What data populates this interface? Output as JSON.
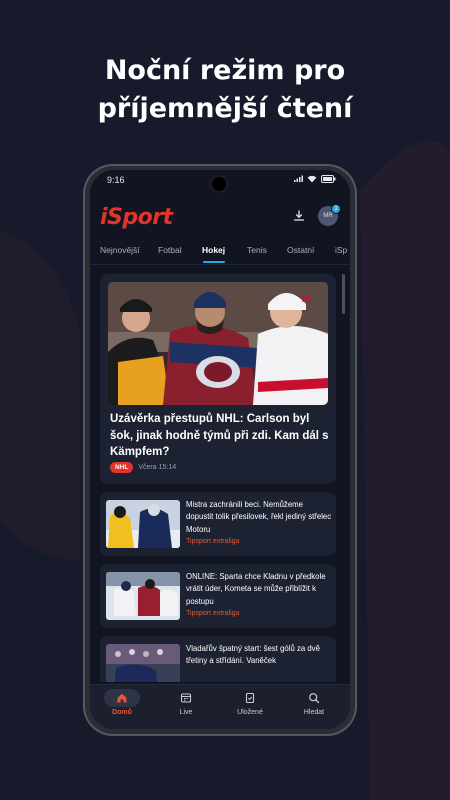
{
  "promo": {
    "line1": "Noční režim pro",
    "line2": "příjemnější čtení"
  },
  "status_bar": {
    "time": "9:16"
  },
  "app": {
    "logo": "iSport",
    "avatar_initials": "MR",
    "avatar_badge": "1"
  },
  "tabs": [
    {
      "label": "Nejnovější"
    },
    {
      "label": "Fotbal"
    },
    {
      "label": "Hokej",
      "active": true
    },
    {
      "label": "Tenis"
    },
    {
      "label": "Ostatní"
    },
    {
      "label": "iSp"
    }
  ],
  "hero": {
    "title": "Uzávěrka přestupů NHL: Carlson byl šok, jinak hodně týmů při zdi. Kam dál s Kämpfem?",
    "badge": "NHL",
    "time": "Včera 15:14"
  },
  "articles": [
    {
      "title": "Mistra zachránili beci. Nemůžeme dopustit tolik přesilovek, řekl jediný střelec Motoru",
      "tag": "Tipsport extraliga"
    },
    {
      "title": "ONLINE: Sparta chce Kladnu v předkole vrátit úder, Kometa se může přiblížit k postupu",
      "tag": "Tipsport extraliga"
    },
    {
      "title": "Vladařův špatný start: šest gólů za dvě třetiny a střídání. Vaněček",
      "tag": ""
    }
  ],
  "bottom_nav": [
    {
      "label": "Domů",
      "icon": "home-icon",
      "active": true
    },
    {
      "label": "Live",
      "icon": "live-icon"
    },
    {
      "label": "Uložené",
      "icon": "bookmark-icon"
    },
    {
      "label": "Hledat",
      "icon": "search-icon"
    }
  ],
  "colors": {
    "background": "#161a2a",
    "accent_red": "#e2342b",
    "tab_indicator": "#2aa8e0",
    "card": "#1d2232"
  }
}
